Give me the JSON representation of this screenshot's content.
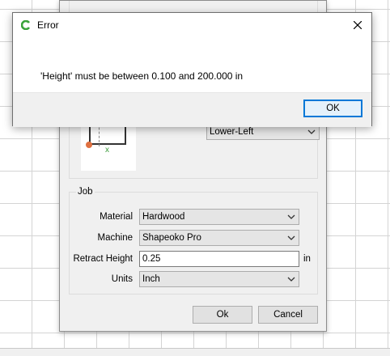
{
  "setup_dialog": {
    "origin_group": {
      "origin_select_value": "Lower-Left",
      "x_marker": "x"
    },
    "job_group": {
      "title": "Job",
      "material_label": "Material",
      "material_value": "Hardwood",
      "machine_label": "Machine",
      "machine_value": "Shapeoko Pro",
      "retract_label": "Retract Height",
      "retract_value": "0.25",
      "retract_unit": "in",
      "units_label": "Units",
      "units_value": "Inch"
    },
    "ok_label": "Ok",
    "cancel_label": "Cancel"
  },
  "error_dialog": {
    "title": "Error",
    "message": "'Height' must be between 0.100 and 200.000 in",
    "ok_label": "OK",
    "icons": {
      "app": "app-logo-icon",
      "close": "close-icon"
    },
    "accent_color": "#0078d7"
  }
}
